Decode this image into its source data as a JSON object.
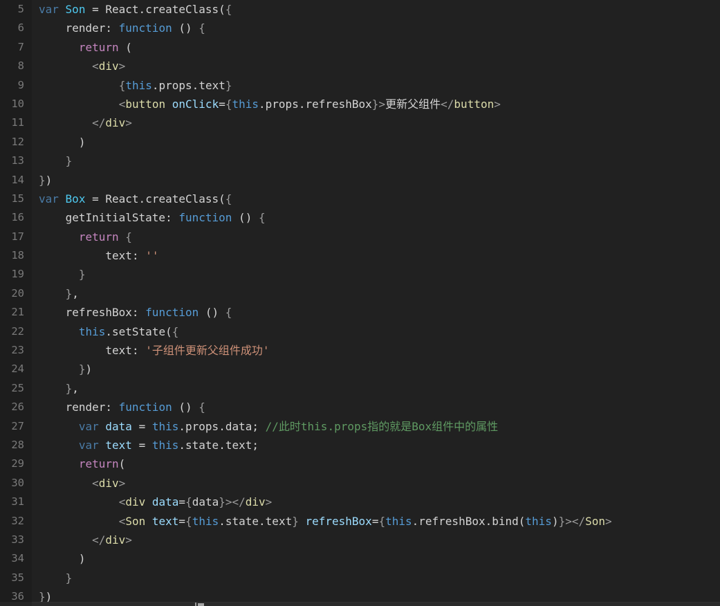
{
  "editor": {
    "theme_name": "dark-plus",
    "background": "#212121",
    "gutter_background": "#1d1d1d",
    "line_number_color": "#7a7a7a",
    "default_text_color": "#d4d4d4",
    "font_size_px": 16,
    "line_height_px": 27.4,
    "first_visible_line": 5,
    "last_visible_line": 37,
    "current_line": 37
  },
  "colors": {
    "keyword_var": "#4a7ba6",
    "keyword_function": "#569cd6",
    "keyword_return": "#c586c0",
    "class_name": "#4ec9f0",
    "jsx_tag": "#dcdcaa",
    "jsx_attribute": "#9cdcfe",
    "string": "#ce9178",
    "comment": "#5f9a62",
    "punctuation": "#9b9b9b",
    "plain": "#d4d4d4"
  },
  "gutter": {
    "line_numbers": [
      "5",
      "6",
      "7",
      "8",
      "9",
      "10",
      "11",
      "12",
      "13",
      "14",
      "15",
      "16",
      "17",
      "18",
      "19",
      "20",
      "21",
      "22",
      "23",
      "24",
      "25",
      "26",
      "27",
      "28",
      "29",
      "30",
      "31",
      "32",
      "33",
      "34",
      "35",
      "36"
    ]
  },
  "code": {
    "language": "javascript-jsx",
    "lines": [
      {
        "number": "5",
        "text": "var Son = React.createClass({"
      },
      {
        "number": "6",
        "text": "    render: function () {"
      },
      {
        "number": "7",
        "text": "      return ("
      },
      {
        "number": "8",
        "text": "        <div>"
      },
      {
        "number": "9",
        "text": "            {this.props.text}"
      },
      {
        "number": "10",
        "text": "            <button onClick={this.props.refreshBox}>更新父组件</button>"
      },
      {
        "number": "11",
        "text": "        </div>"
      },
      {
        "number": "12",
        "text": "      )"
      },
      {
        "number": "13",
        "text": "    }"
      },
      {
        "number": "14",
        "text": "})"
      },
      {
        "number": "15",
        "text": "var Box = React.createClass({"
      },
      {
        "number": "16",
        "text": "    getInitialState: function () {"
      },
      {
        "number": "17",
        "text": "      return {"
      },
      {
        "number": "18",
        "text": "          text: ''"
      },
      {
        "number": "19",
        "text": "      }"
      },
      {
        "number": "20",
        "text": "    },"
      },
      {
        "number": "21",
        "text": "    refreshBox: function () {"
      },
      {
        "number": "22",
        "text": "      this.setState({"
      },
      {
        "number": "23",
        "text": "          text: '子组件更新父组件成功'"
      },
      {
        "number": "24",
        "text": "      })"
      },
      {
        "number": "25",
        "text": "    },"
      },
      {
        "number": "26",
        "text": "    render: function () {"
      },
      {
        "number": "27",
        "text": "      var data = this.props.data; //此时this.props指的就是Box组件中的属性"
      },
      {
        "number": "28",
        "text": "      var text = this.state.text;"
      },
      {
        "number": "29",
        "text": "      return("
      },
      {
        "number": "30",
        "text": "        <div>"
      },
      {
        "number": "31",
        "text": "            <div data={data}></div>"
      },
      {
        "number": "32",
        "text": "            <Son text={this.state.text} refreshBox={this.refreshBox.bind(this)}></Son>"
      },
      {
        "number": "33",
        "text": "        </div>"
      },
      {
        "number": "34",
        "text": "      )"
      },
      {
        "number": "35",
        "text": "    }"
      },
      {
        "number": "36",
        "text": "})"
      }
    ],
    "comments": [
      "//此时this.props指的就是Box组件中的属性"
    ],
    "strings": [
      "''",
      "'子组件更新父组件成功'"
    ],
    "chinese_text": [
      "更新父组件",
      "子组件更新父组件成功",
      "此时this.props指的就是Box组件中的属性"
    ]
  }
}
